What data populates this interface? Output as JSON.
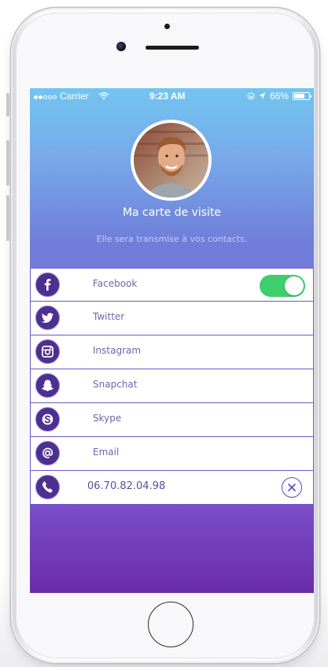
{
  "status_bar": {
    "carrier": "Carrier",
    "time": "9:23 AM",
    "battery": "66%"
  },
  "profile": {
    "title": "Ma carte de visite",
    "subtitle": "Elle sera transmise à vos contacts."
  },
  "networks": [
    {
      "label": "Facebook",
      "icon": "facebook-icon",
      "enabled": true
    },
    {
      "label": "Twitter",
      "icon": "twitter-icon"
    },
    {
      "label": "Instagram",
      "icon": "instagram-icon"
    },
    {
      "label": "Snapchat",
      "icon": "snapchat-icon"
    },
    {
      "label": "Skype",
      "icon": "skype-icon"
    },
    {
      "label": "Email",
      "icon": "at-icon"
    },
    {
      "label": "06.70.82.04.98",
      "icon": "phone-icon"
    }
  ],
  "colors": {
    "accent": "#6b56c9",
    "icon_bg": "#4d2f8f",
    "toggle_on": "#3fce6e"
  }
}
